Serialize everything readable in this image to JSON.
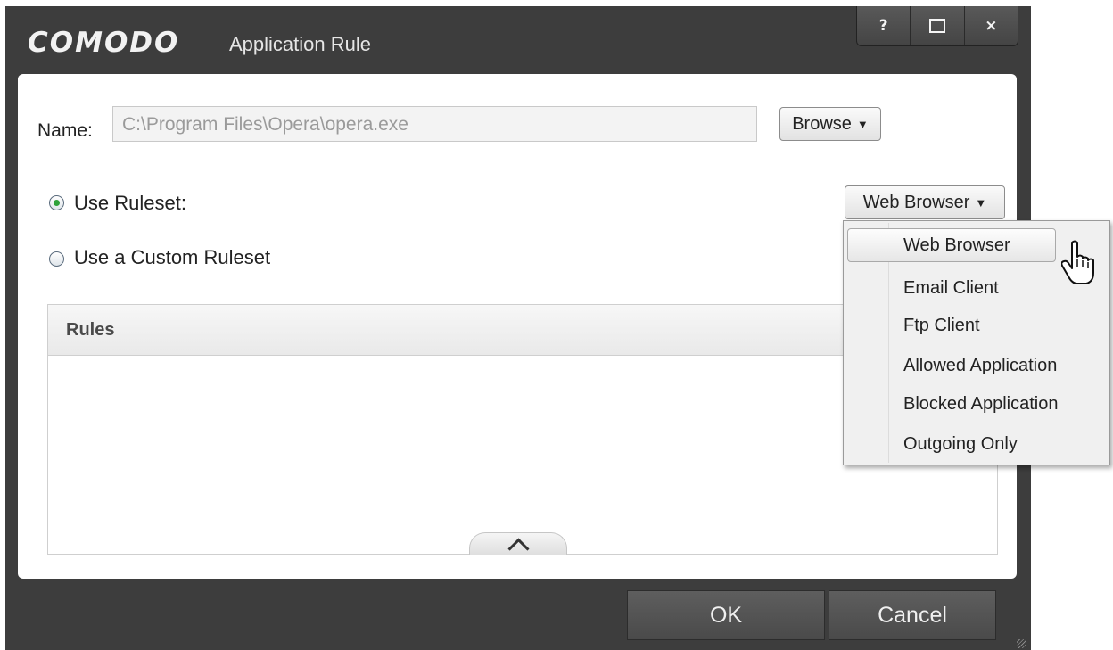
{
  "window": {
    "brand": "COMODO",
    "title": "Application Rule",
    "controls": {
      "help": "?",
      "close": "×"
    }
  },
  "form": {
    "name_label": "Name:",
    "name_value": "C:\\Program Files\\Opera\\opera.exe",
    "browse_label": "Browse",
    "use_ruleset_label": "Use Ruleset:",
    "use_custom_label": "Use a Custom Ruleset",
    "ruleset_selected": "Web Browser",
    "ruleset_mode": "use-ruleset"
  },
  "rules_panel": {
    "header": "Rules"
  },
  "dropdown": {
    "items": [
      {
        "label": "Web Browser"
      },
      {
        "label": "Email Client"
      },
      {
        "label": "Ftp Client"
      },
      {
        "label": "Allowed Application"
      },
      {
        "label": "Blocked Application"
      },
      {
        "label": "Outgoing Only"
      }
    ]
  },
  "footer": {
    "ok_label": "OK",
    "cancel_label": "Cancel"
  },
  "colors": {
    "chrome": "#3d3d3d",
    "radio_selected": "#2fa23a",
    "panel": "#ffffff"
  },
  "icons": [
    "help-icon",
    "maximize-icon",
    "close-icon",
    "dropdown-caret-icon",
    "chevron-up-icon",
    "hand-cursor-icon",
    "resize-grip-icon"
  ]
}
